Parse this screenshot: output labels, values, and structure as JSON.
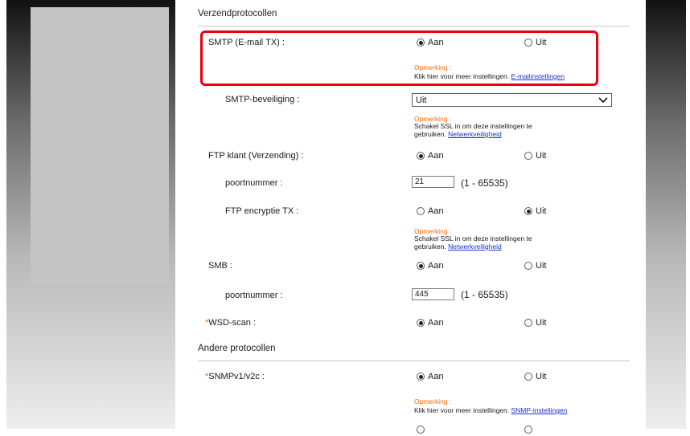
{
  "sections": {
    "send_protocols": "Verzendprotocollen",
    "other_protocols": "Andere protocollen"
  },
  "radio_labels": {
    "on": "Aan",
    "off": "Uit"
  },
  "note_title": "Opmerking :",
  "rows": {
    "smtp": {
      "label": "SMTP (E-mail TX) :",
      "selected": "Aan",
      "note": "Klik hier voor meer instellingen.",
      "link": "E-mailinstellingen"
    },
    "smtp_security": {
      "label": "SMTP-beveiliging :",
      "value": "Uit",
      "note_line1": "Schakel SSL in om deze instellingen te",
      "note_line2": "gebruiken.",
      "link": "Netwerkveiligheid"
    },
    "ftp_client": {
      "label": "FTP klant (Verzending) :",
      "selected": "Aan"
    },
    "ftp_port": {
      "label": "poortnummer :",
      "value": "21",
      "range": "(1 - 65535)"
    },
    "ftp_encryption": {
      "label": "FTP encryptie TX :",
      "selected": "Uit",
      "note_line1": "Schakel SSL in om deze instellingen te",
      "note_line2": "gebruiken.",
      "link": "Netwerkveiligheid"
    },
    "smb": {
      "label": "SMB :",
      "selected": "Aan"
    },
    "smb_port": {
      "label": "poortnummer :",
      "value": "445",
      "range": "(1 - 65535)"
    },
    "wsd_scan": {
      "required_mark": "*",
      "label": "WSD-scan :",
      "selected": "Aan"
    },
    "snmp": {
      "required_mark": "*",
      "label": "SNMPv1/v2c :",
      "selected": "Aan",
      "note": "Klik hier voor meer instellingen.",
      "link": "SNMP-instellingen"
    }
  },
  "colors": {
    "highlight": "#e8000b",
    "note_title": "#ff6a00",
    "link": "#1a32c8"
  }
}
